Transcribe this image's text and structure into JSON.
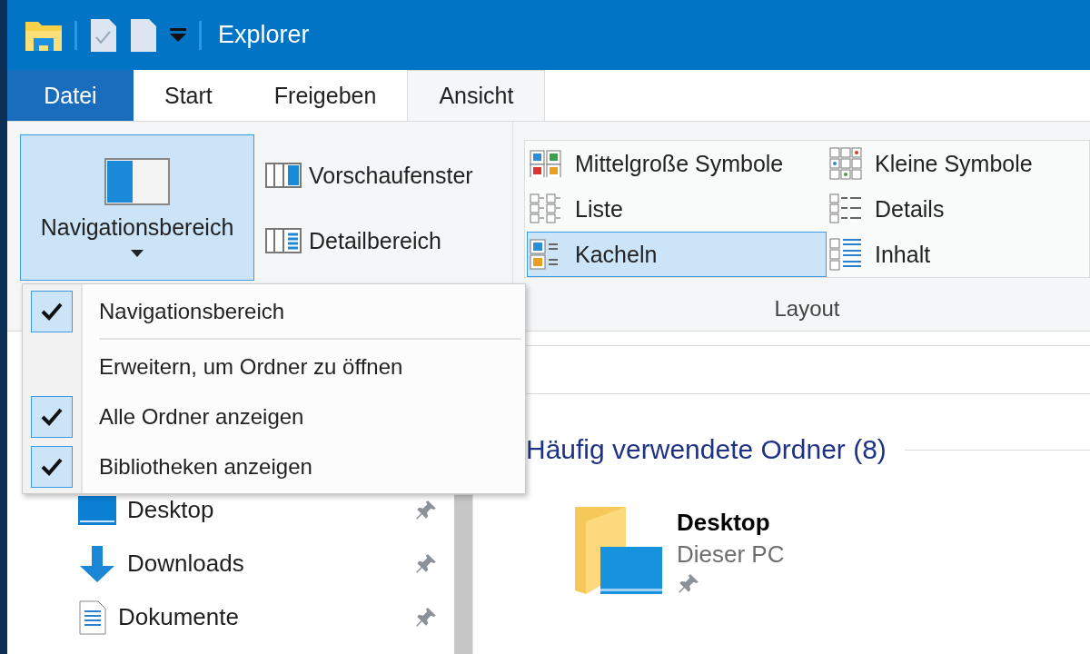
{
  "window": {
    "title": "Explorer"
  },
  "tabs": [
    {
      "label": "Datei",
      "kind": "file",
      "selected": false
    },
    {
      "label": "Start",
      "kind": "tab",
      "selected": false
    },
    {
      "label": "Freigeben",
      "kind": "tab",
      "selected": false
    },
    {
      "label": "Ansicht",
      "kind": "tab",
      "selected": true
    }
  ],
  "ribbon": {
    "panes": {
      "big_button": {
        "label": "Navigationsbereich",
        "selected": true
      },
      "buttons": [
        {
          "label": "Vorschaufenster"
        },
        {
          "label": "Detailbereich"
        }
      ]
    },
    "layout": {
      "label": "Layout",
      "options": [
        {
          "label": "Mittelgroße Symbole",
          "selected": false
        },
        {
          "label": "Kleine Symbole",
          "selected": false
        },
        {
          "label": "Liste",
          "selected": false
        },
        {
          "label": "Details",
          "selected": false
        },
        {
          "label": "Kacheln",
          "selected": true
        },
        {
          "label": "Inhalt",
          "selected": false
        }
      ]
    }
  },
  "nav_menu": {
    "items": [
      {
        "kind": "option",
        "label": "Navigationsbereich",
        "checked": true
      },
      {
        "kind": "separator"
      },
      {
        "kind": "option",
        "label": "Erweitern, um Ordner zu öffnen",
        "checked": false
      },
      {
        "kind": "option",
        "label": "Alle Ordner anzeigen",
        "checked": true
      },
      {
        "kind": "option",
        "label": "Bibliotheken anzeigen",
        "checked": true
      }
    ]
  },
  "nav_pane": {
    "items": [
      {
        "label": "Desktop",
        "pinned": true
      },
      {
        "label": "Downloads",
        "pinned": true
      },
      {
        "label": "Dokumente",
        "pinned": true
      }
    ]
  },
  "content": {
    "group": {
      "title": "Häufig verwendete Ordner (8)",
      "items": [
        {
          "name": "Desktop",
          "location": "Dieser PC",
          "pinned": true
        }
      ]
    }
  }
}
